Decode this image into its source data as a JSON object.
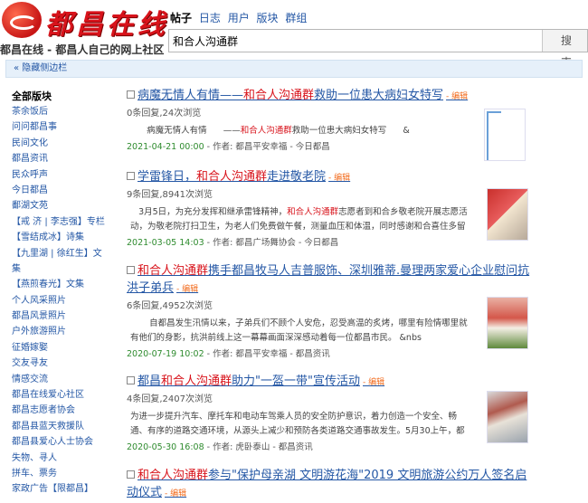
{
  "site": {
    "logo_text": "都昌在线",
    "slogan": "都昌在线 - 都昌人自己的网上社区"
  },
  "search": {
    "tabs": [
      "帖子",
      "日志",
      "用户",
      "版块",
      "群组"
    ],
    "active_tab": "帖子",
    "query": "和合人沟通群",
    "button": "搜 索"
  },
  "toggle_label": "« 隐藏侧边栏",
  "sidebar": {
    "head": "全部版块",
    "items": [
      "茶余饭后",
      "问问都昌事",
      "民间文化",
      "都昌资讯",
      "民众呼声",
      "今日都昌",
      "鄱湖文苑",
      "【戒 济 | 李志强】专栏",
      "【雪结成冰】诗集",
      "【九里湖 | 徐红生】文",
      "集",
      "【燕煎春光】文集",
      "个人风采照片",
      "都昌风景照片",
      "户外旅游照片",
      "征婚嫁娶",
      "交友寻友",
      "情感交流",
      "都昌在线爱心社区",
      "都昌志愿者协会",
      "都昌县蓝天救援队",
      "都昌县爱心人士协会",
      "失物、寻人",
      "拼车、票务",
      "家政广告【限都昌】"
    ]
  },
  "edit_label": "- 编辑",
  "posts": [
    {
      "title_pre": "病魔无情人有情——",
      "title_hl": "和合人沟通群",
      "title_post": "救助一位患大病妇女特写",
      "title2": "",
      "meta": "0条回复,24次浏览",
      "summary_pre": "      病魔无情人有情      ——",
      "summary_hl": "和合人沟通群",
      "summary_post": "救助一位患大病妇女特写      &",
      "date": "2021-04-21 00:00",
      "author": "都昌平安幸福",
      "forum": "今日都昌"
    },
    {
      "title_pre": "学雷锋日，",
      "title_hl": "和合人沟通群",
      "title_post": "走进敬老院",
      "title2": "",
      "meta": "9条回复,8941次浏览",
      "summary_pre": "   3月5日，为充分发挥和继承雷锋精神，",
      "summary_hl": "和合人沟通群",
      "summary_post": "志愿者到和合乡敬老院开展志愿活动，为敬老院打扫卫生，为老人们免费做午餐，测量血压和体温，同时感谢和合喜住多留",
      "date": "2021-03-05 14:03",
      "author": "都昌广场舞协会",
      "forum": "今日都昌"
    },
    {
      "title_pre": "",
      "title_hl": "和合人沟通群",
      "title_post": "携手都昌牧马人吉普服饰、深圳雅蒂.曼理两家爱心企业慰问抗",
      "title2": "洪子弟兵",
      "meta": "6条回复,4952次浏览",
      "summary_pre": "       自都昌发生汛情以来，子弟兵们不顾个人安危，忍受高温的炙烤，哪里有险情哪里就有他们的身影，抗洪前线上这一幕幕画面深深感动着每一位都昌市民。 &nbs",
      "summary_hl": "",
      "summary_post": "",
      "date": "2020-07-19 10:02",
      "author": "都昌平安幸福",
      "forum": "都昌资讯"
    },
    {
      "title_pre": "都昌",
      "title_hl": "和合人沟通群",
      "title_post": "助力\"一盔一带\"宣传活动",
      "title2": "",
      "meta": "4条回复,2407次浏览",
      "summary_pre": "为进一步提升汽车、摩托车和电动车驾乘人员的安全防护意识，着力创造一个安全、畅通、有序的道路交通环境，从源头上减少和预防各类道路交通事故发生。5月30上午，都昌",
      "summary_hl": "",
      "summary_post": "",
      "date": "2020-05-30 16:08",
      "author": "虎卧泰山",
      "forum": "都昌资讯"
    },
    {
      "title_pre": "",
      "title_hl": "和合人沟通群",
      "title_post": "参与\"保护母亲湖 文明游花海\"2019 文明旅游公约万人签名启",
      "title2": "动仪式",
      "meta": "",
      "summary_pre": "",
      "summary_hl": "",
      "summary_post": "",
      "date": "",
      "author": "",
      "forum": ""
    }
  ],
  "author_prefix": "作者: ",
  "colors": {
    "brand_red": "#d8131b",
    "link_blue": "#2457a5",
    "date_green": "#2e8b2e",
    "edit_orange": "#f26b1d"
  }
}
